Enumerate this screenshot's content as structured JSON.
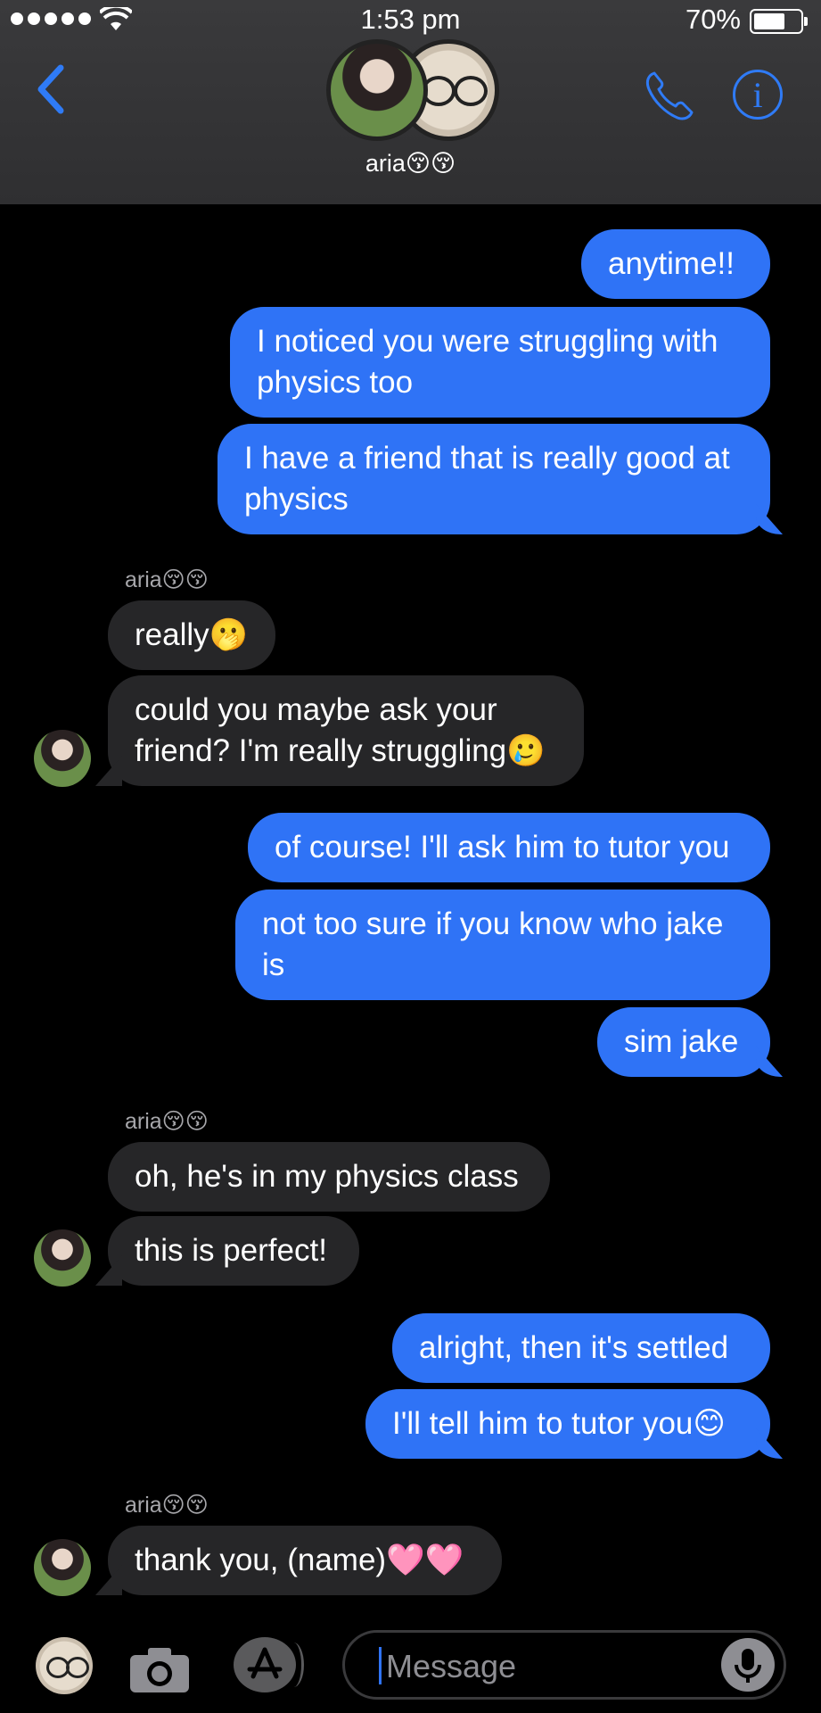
{
  "status_bar": {
    "time": "1:53 pm",
    "battery": "70%",
    "battery_level": 0.7
  },
  "header": {
    "chat_name": "aria😚😚"
  },
  "messages": [
    {
      "dir": "out",
      "text": "anytime!!"
    },
    {
      "dir": "out",
      "text": "I noticed you were struggling with physics too"
    },
    {
      "dir": "out",
      "text": "I have a friend that is really good at physics"
    },
    {
      "dir": "sender",
      "text": "aria😚😚"
    },
    {
      "dir": "in",
      "text": "really🫢"
    },
    {
      "dir": "in",
      "text": "could you maybe ask your friend? I'm really struggling🥲"
    },
    {
      "dir": "out",
      "text": "of course! I'll ask him to tutor you"
    },
    {
      "dir": "out",
      "text": "not too sure if you know who jake is"
    },
    {
      "dir": "out",
      "text": "sim jake"
    },
    {
      "dir": "sender",
      "text": "aria😚😚"
    },
    {
      "dir": "in",
      "text": "oh, he's in my physics class"
    },
    {
      "dir": "in",
      "text": "this is perfect!"
    },
    {
      "dir": "out",
      "text": "alright, then it's settled"
    },
    {
      "dir": "out",
      "text": "I'll tell him to tutor you😊"
    },
    {
      "dir": "sender",
      "text": "aria😚😚"
    },
    {
      "dir": "in",
      "text": "thank you, (name)🩷🩷"
    }
  ],
  "input": {
    "placeholder": "Message",
    "value": ""
  },
  "icons": [
    "back-chevron-icon",
    "phone-icon",
    "info-icon",
    "camera-icon",
    "app-store-icon",
    "microphone-icon"
  ],
  "colors": {
    "outgoing_bubble": "#2f73f6",
    "incoming_bubble": "#262628",
    "accent": "#2f7bf6"
  }
}
